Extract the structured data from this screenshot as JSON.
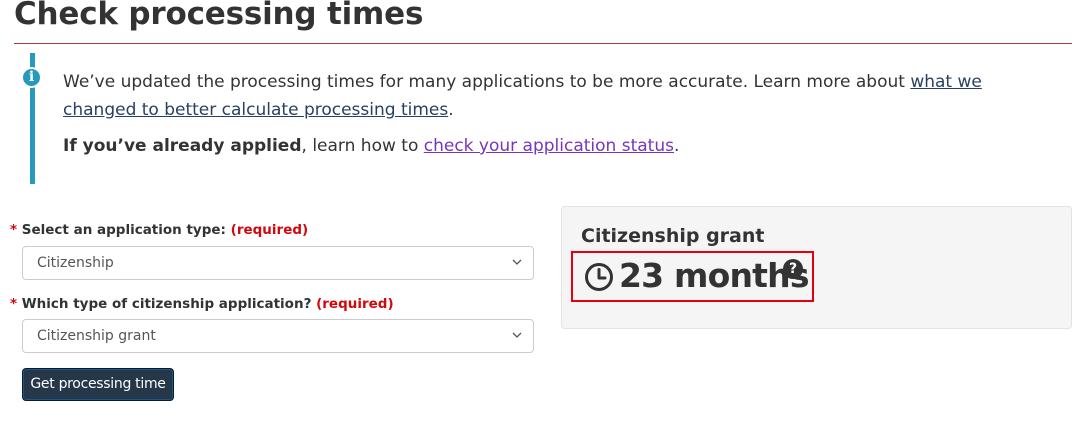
{
  "page": {
    "title": "Check processing times"
  },
  "alert": {
    "text_before_link": "We’ve updated the processing times for many applications to be more accurate. Learn more about ",
    "link_1": "what we changed to better calculate processing times",
    "text_after_link": ".",
    "bold_text": "If you’ve already applied",
    "text_middle": ", learn how to ",
    "link_2": "check your application status",
    "text_end": ".",
    "icon": "info-icon"
  },
  "form": {
    "application_type": {
      "star": "*",
      "label": "Select an application type:",
      "required": "(required)",
      "value": "Citizenship"
    },
    "citizenship_type": {
      "star": "*",
      "label": "Which type of citizenship application?",
      "required": "(required)",
      "value": "Citizenship grant"
    },
    "submit_label": "Get processing time"
  },
  "result": {
    "title": "Citizenship grant",
    "value": "23 months",
    "clock_icon": "clock-icon",
    "help_icon": "question-circle-icon",
    "help_glyph": "?"
  },
  "colors": {
    "title_rule": "#af3c43",
    "alert_accent": "#269abc",
    "required": "#d3080c",
    "button_bg": "#26374a",
    "highlight_border": "#e3000f",
    "link": "#284162",
    "visited_link": "#7834bc"
  }
}
